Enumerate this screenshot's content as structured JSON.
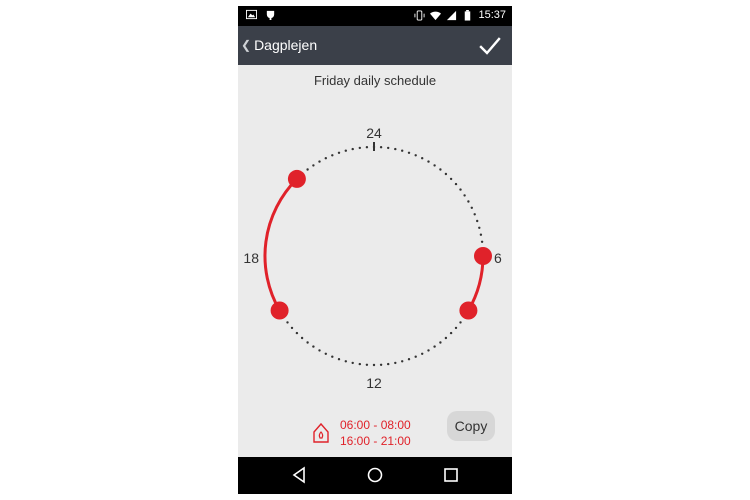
{
  "status_bar": {
    "time": "15:37",
    "left_icons": [
      "image-notification-icon",
      "android-debug-icon"
    ],
    "right_icons": [
      "vibrate-icon",
      "wifi-icon",
      "cell-signal-icon",
      "battery-icon"
    ]
  },
  "toolbar": {
    "back_label": "Dagplejen",
    "back_icon": "chevron-left-icon",
    "confirm_icon": "checkmark-icon"
  },
  "schedule": {
    "title": "Friday daily schedule",
    "hour_labels": {
      "top": "24",
      "right": "6",
      "bottom": "12",
      "left": "18"
    },
    "periods": [
      {
        "start": "06:00",
        "end": "08:00"
      },
      {
        "start": "16:00",
        "end": "21:00"
      }
    ],
    "accent_color": "#e0222a",
    "icon": "home-icon"
  },
  "summary": {
    "line1": "06:00 - 08:00",
    "line2": "16:00 - 21:00"
  },
  "copy_button": {
    "label": "Copy"
  },
  "nav_bar": {
    "buttons": [
      "back-triangle-icon",
      "home-circle-icon",
      "recents-square-icon"
    ]
  }
}
